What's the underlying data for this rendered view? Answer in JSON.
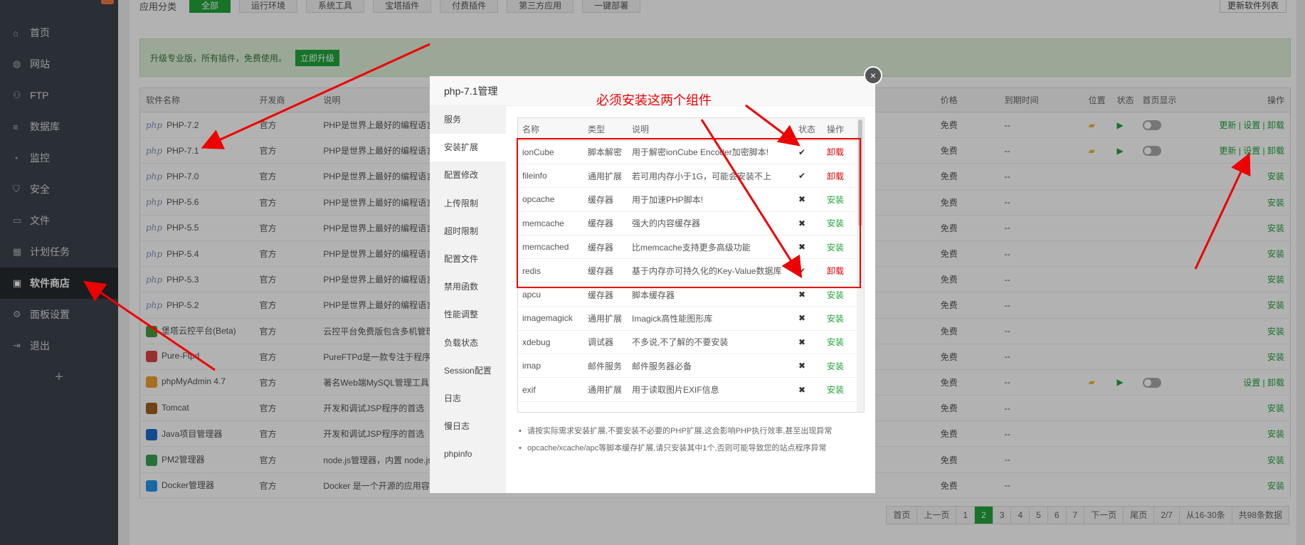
{
  "sidebar": {
    "items": [
      {
        "label": "首页",
        "icon": "home-icon",
        "glyph": "⌂"
      },
      {
        "label": "网站",
        "icon": "globe-icon",
        "glyph": "◍"
      },
      {
        "label": "FTP",
        "icon": "ftp-icon",
        "glyph": "⚇"
      },
      {
        "label": "数据库",
        "icon": "database-icon",
        "glyph": "≡"
      },
      {
        "label": "监控",
        "icon": "monitor-icon",
        "glyph": "◔"
      },
      {
        "label": "安全",
        "icon": "shield-icon",
        "glyph": "⛉"
      },
      {
        "label": "文件",
        "icon": "folder-icon",
        "glyph": "▭"
      },
      {
        "label": "计划任务",
        "icon": "calendar-icon",
        "glyph": "▦"
      },
      {
        "label": "软件商店",
        "icon": "grid-icon",
        "glyph": "▣"
      },
      {
        "label": "面板设置",
        "icon": "gear-icon",
        "glyph": "⚙"
      },
      {
        "label": "退出",
        "icon": "logout-icon",
        "glyph": "⇥"
      }
    ],
    "add_label": "+"
  },
  "categories": {
    "label": "应用分类",
    "items": [
      "全部",
      "运行环境",
      "系统工具",
      "宝塔插件",
      "付费插件",
      "第三方应用",
      "一键部署"
    ],
    "update_list": "更新软件列表"
  },
  "banner": {
    "text": "升级专业版，所有插件，免费使用。",
    "button": "立即升级"
  },
  "table": {
    "headers": {
      "name": "软件名称",
      "dev": "开发商",
      "desc": "说明",
      "price": "价格",
      "expire": "到期时间",
      "location": "位置",
      "status": "状态",
      "home": "首页显示",
      "ops": "操作"
    },
    "rows": [
      {
        "name": "PHP-7.2",
        "dev": "官方",
        "desc": "PHP是世界上最好的编程语言",
        "price": "免费",
        "expire": "--",
        "ops": "更新 | 设置 | 卸载"
      },
      {
        "name": "PHP-7.1",
        "dev": "官方",
        "desc": "PHP是世界上最好的编程语言",
        "price": "免费",
        "expire": "--",
        "ops": "更新 | 设置 | 卸载"
      },
      {
        "name": "PHP-7.0",
        "dev": "官方",
        "desc": "PHP是世界上最好的编程语言",
        "price": "免费",
        "expire": "--",
        "ops": "安装"
      },
      {
        "name": "PHP-5.6",
        "dev": "官方",
        "desc": "PHP是世界上最好的编程语言",
        "price": "免费",
        "expire": "--",
        "ops": "安装"
      },
      {
        "name": "PHP-5.5",
        "dev": "官方",
        "desc": "PHP是世界上最好的编程语言",
        "price": "免费",
        "expire": "--",
        "ops": "安装"
      },
      {
        "name": "PHP-5.4",
        "dev": "官方",
        "desc": "PHP是世界上最好的编程语言",
        "price": "免费",
        "expire": "--",
        "ops": "安装"
      },
      {
        "name": "PHP-5.3",
        "dev": "官方",
        "desc": "PHP是世界上最好的编程语言",
        "price": "免费",
        "expire": "--",
        "ops": "安装"
      },
      {
        "name": "PHP-5.2",
        "dev": "官方",
        "desc": "PHP是世界上最好的编程语言",
        "price": "免费",
        "expire": "--",
        "ops": "安装"
      },
      {
        "name": "堡塔云控平台(Beta)",
        "dev": "官方",
        "desc": "云控平台免费版包含多机管理",
        "price": "免费",
        "expire": "--",
        "ops": "安装"
      },
      {
        "name": "Pure-Ftpd",
        "dev": "官方",
        "desc": "PureFTPd是一款专注于程序",
        "price": "免费",
        "expire": "--",
        "ops": "安装"
      },
      {
        "name": "phpMyAdmin 4.7",
        "dev": "官方",
        "desc": "著名Web端MySQL管理工具",
        "price": "免费",
        "expire": "--",
        "ops": "设置 | 卸载"
      },
      {
        "name": "Tomcat",
        "dev": "官方",
        "desc": "开发和调试JSP程序的首选",
        "price": "免费",
        "expire": "--",
        "ops": "安装"
      },
      {
        "name": "Java项目管理器",
        "dev": "官方",
        "desc": "开发和调试JSP程序的首选",
        "price": "免费",
        "expire": "--",
        "ops": "安装"
      },
      {
        "name": "PM2管理器",
        "dev": "官方",
        "desc": "node.js管理器，内置 node.js",
        "price": "免费",
        "expire": "--",
        "ops": "安装"
      },
      {
        "name": "Docker管理器",
        "dev": "官方",
        "desc": "Docker 是一个开源的应用容器",
        "price": "免费",
        "expire": "--",
        "ops": "安装"
      }
    ]
  },
  "pagination": [
    "首页",
    "上一页",
    "1",
    "2",
    "3",
    "4",
    "5",
    "6",
    "7",
    "下一页",
    "尾页",
    "2/7",
    "从16-30条",
    "共98条数据"
  ],
  "modal": {
    "title": "php-7.1管理",
    "close": "×",
    "menu": [
      "服务",
      "安装扩展",
      "配置修改",
      "上传限制",
      "超时限制",
      "配置文件",
      "禁用函数",
      "性能调整",
      "负载状态",
      "Session配置",
      "日志",
      "慢日志",
      "phpinfo"
    ],
    "ext_headers": {
      "name": "名称",
      "type": "类型",
      "desc": "说明",
      "status": "状态",
      "op": "操作"
    },
    "extensions": [
      {
        "name": "ionCube",
        "type": "脚本解密",
        "desc": "用于解密ionCube Encoder加密脚本!",
        "status": "✔",
        "op": "卸载"
      },
      {
        "name": "fileinfo",
        "type": "通用扩展",
        "desc": "若可用内存小于1G，可能会安装不上",
        "status": "✔",
        "op": "卸载"
      },
      {
        "name": "opcache",
        "type": "缓存器",
        "desc": "用于加速PHP脚本!",
        "status": "✖",
        "op": "安装"
      },
      {
        "name": "memcache",
        "type": "缓存器",
        "desc": "强大的内容缓存器",
        "status": "✖",
        "op": "安装"
      },
      {
        "name": "memcached",
        "type": "缓存器",
        "desc": "比memcache支持更多高级功能",
        "status": "✖",
        "op": "安装"
      },
      {
        "name": "redis",
        "type": "缓存器",
        "desc": "基于内存亦可持久化的Key-Value数据库",
        "status": "✔",
        "op": "卸载"
      },
      {
        "name": "apcu",
        "type": "缓存器",
        "desc": "脚本缓存器",
        "status": "✖",
        "op": "安装"
      },
      {
        "name": "imagemagick",
        "type": "通用扩展",
        "desc": "Imagick高性能图形库",
        "status": "✖",
        "op": "安装"
      },
      {
        "name": "xdebug",
        "type": "调试器",
        "desc": "不多说,不了解的不要安装",
        "status": "✖",
        "op": "安装"
      },
      {
        "name": "imap",
        "type": "邮件服务",
        "desc": "邮件服务器必备",
        "status": "✖",
        "op": "安装"
      },
      {
        "name": "exif",
        "type": "通用扩展",
        "desc": "用于读取图片EXIF信息",
        "status": "✖",
        "op": "安装"
      }
    ],
    "notes": [
      "请按实际需求安装扩展,不要安装不必要的PHP扩展,这会影响PHP执行效率,甚至出现异常",
      "opcache/xcache/apc等脚本缓存扩展,请只安装其中1个,否则可能导致您的站点程序异常"
    ]
  },
  "annotation": {
    "text": "必须安装这两个组件",
    "color": "#e00000"
  }
}
